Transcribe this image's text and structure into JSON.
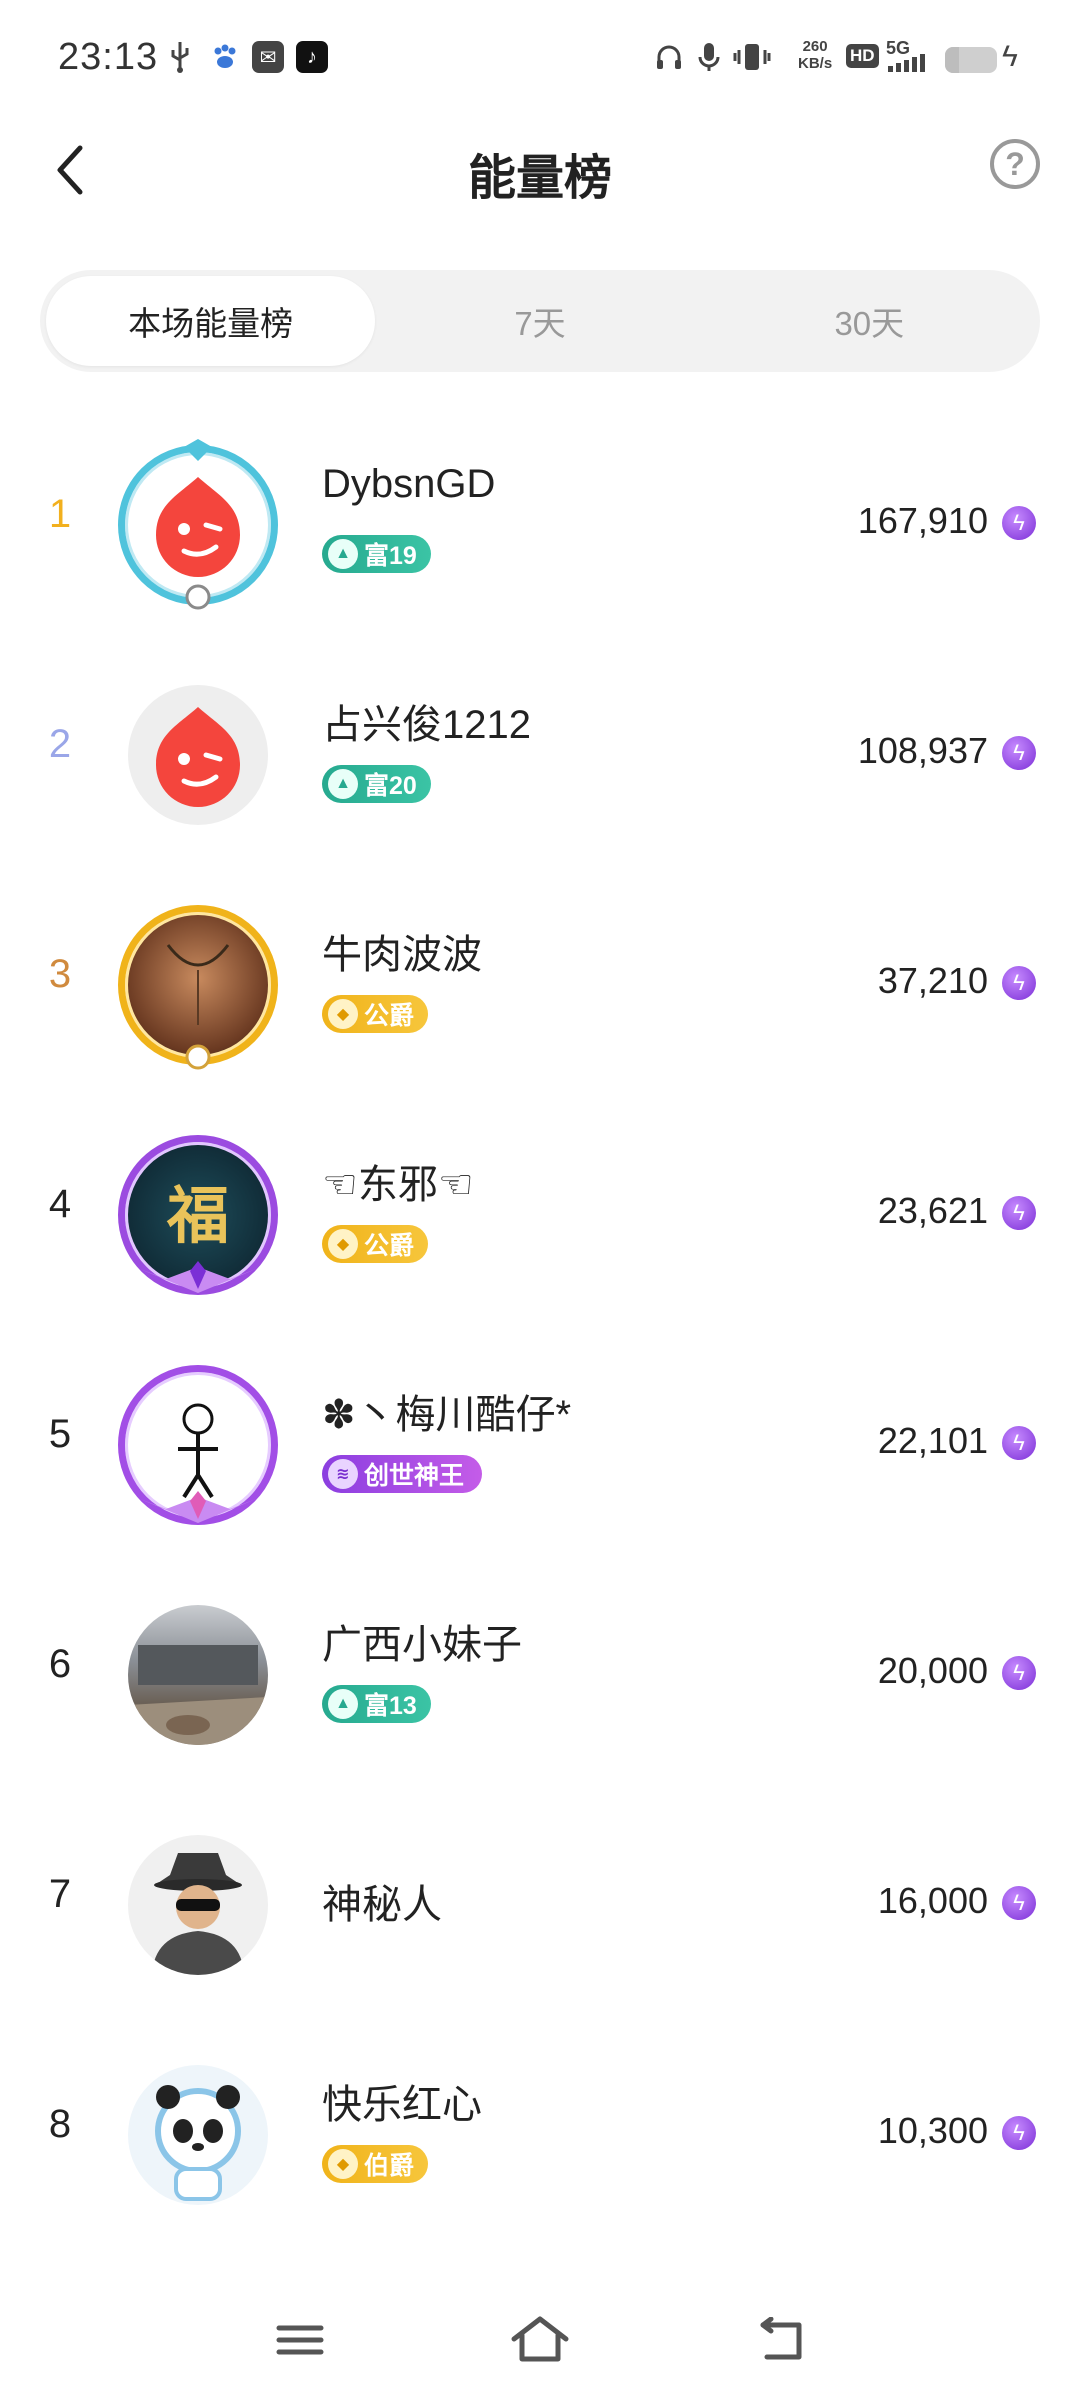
{
  "status_bar": {
    "time": "23:13",
    "net_speed_value": "260",
    "net_speed_unit": "KB/s",
    "hd_label": "HD",
    "signal_label": "5G",
    "icons": [
      "usb-icon",
      "paw-icon",
      "mail-icon",
      "tiktok-icon",
      "headphones-icon",
      "mic-icon",
      "vibrate-icon",
      "battery-icon",
      "charging-icon"
    ]
  },
  "header": {
    "title": "能量榜",
    "help_glyph": "?"
  },
  "tabs": [
    {
      "label": "本场能量榜",
      "active": true
    },
    {
      "label": "7天",
      "active": false
    },
    {
      "label": "30天",
      "active": false
    }
  ],
  "ranking": [
    {
      "rank": "1",
      "name": "DybsnGD",
      "badge": "富19",
      "badge_type": "rich",
      "score": "167,910",
      "rank_color": "#f2b01e"
    },
    {
      "rank": "2",
      "name": "占兴俊1212",
      "badge": "富20",
      "badge_type": "rich",
      "score": "108,937",
      "rank_color": "#9aa6e8"
    },
    {
      "rank": "3",
      "name": "牛肉波波",
      "badge": "公爵",
      "badge_type": "gold",
      "score": "37,210",
      "rank_color": "#d08a3e"
    },
    {
      "rank": "4",
      "name": "☜东邪☜",
      "badge": "公爵",
      "badge_type": "gold",
      "score": "23,621",
      "rank_color": "#222222"
    },
    {
      "rank": "5",
      "name": "✽丶梅川酷仔*",
      "badge": "创世神王",
      "badge_type": "purple",
      "score": "22,101",
      "rank_color": "#222222"
    },
    {
      "rank": "6",
      "name": "广西小妹子",
      "badge": "富13",
      "badge_type": "rich",
      "score": "20,000",
      "rank_color": "#222222"
    },
    {
      "rank": "7",
      "name": "神秘人",
      "badge": "",
      "badge_type": "none",
      "score": "16,000",
      "rank_color": "#222222"
    },
    {
      "rank": "8",
      "name": "快乐红心",
      "badge": "伯爵",
      "badge_type": "gold",
      "score": "10,300",
      "rank_color": "#222222"
    }
  ],
  "colors": {
    "accent_purple": "#7b2fd6",
    "rich_badge": "#26a98f",
    "gold_badge": "#f0b31a",
    "purple_badge": "#8b3ee0",
    "default_avatar": "#f4453d"
  },
  "nav_bar": {
    "icons": [
      "menu-icon",
      "home-icon",
      "back-nav-icon"
    ]
  }
}
